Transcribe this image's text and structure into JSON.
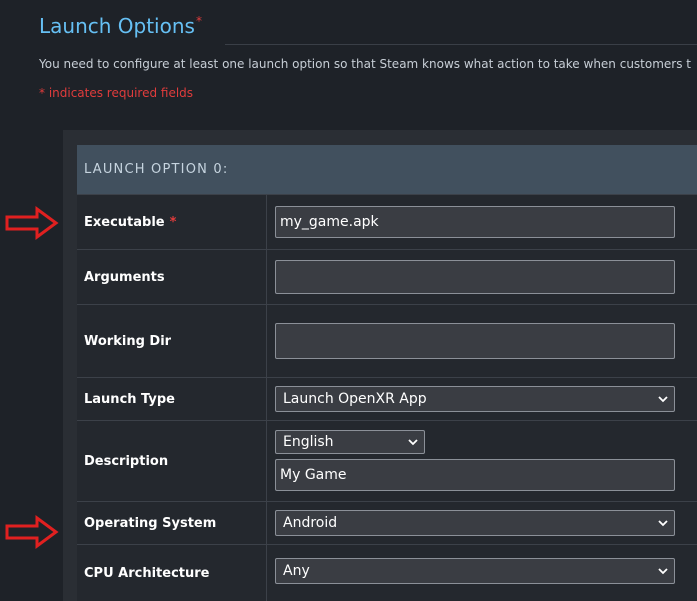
{
  "section": {
    "title": "Launch Options",
    "title_star": "*",
    "intro": "You need to configure at least one launch option so that Steam knows what action to take when customers t",
    "required_note": "* indicates required fields"
  },
  "launch_option": {
    "header": "LAUNCH OPTION 0:",
    "rows": {
      "executable": {
        "label": "Executable",
        "star": "*",
        "value": "my_game.apk"
      },
      "arguments": {
        "label": "Arguments",
        "value": ""
      },
      "working_dir": {
        "label": "Working Dir",
        "value": ""
      },
      "launch_type": {
        "label": "Launch Type",
        "selected": "Launch OpenXR App"
      },
      "description": {
        "label": "Description",
        "language": "English",
        "value": "My Game"
      },
      "operating_system": {
        "label": "Operating System",
        "selected": "Android"
      },
      "cpu_architecture": {
        "label": "CPU Architecture",
        "selected": "Any"
      }
    }
  },
  "annotations": {
    "arrow_icon": "right-arrow-outline-icon",
    "arrow_color": "#e02020"
  },
  "colors": {
    "accent": "#66c0f4",
    "required": "#e03c3c",
    "header_bg": "#41505e"
  }
}
